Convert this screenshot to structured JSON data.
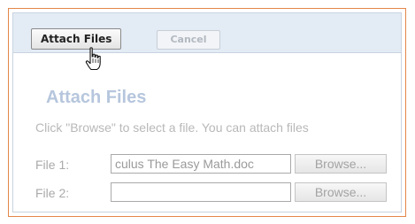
{
  "toolbar": {
    "attach_label": "Attach Files",
    "cancel_label": "Cancel"
  },
  "dialog": {
    "title": "Attach Files",
    "instructions": "Click \"Browse\" to select a file. You can attach files",
    "files": [
      {
        "label": "File 1:",
        "value": "culus The Easy Math.doc",
        "browse_label": "Browse..."
      },
      {
        "label": "File 2:",
        "value": "",
        "browse_label": "Browse..."
      }
    ]
  },
  "cursor": {
    "icon": "hand-pointer-icon"
  },
  "colors": {
    "frame_border": "#e4864a",
    "toolbar_bg": "#e3ebf5",
    "title": "#b6c6dd"
  }
}
